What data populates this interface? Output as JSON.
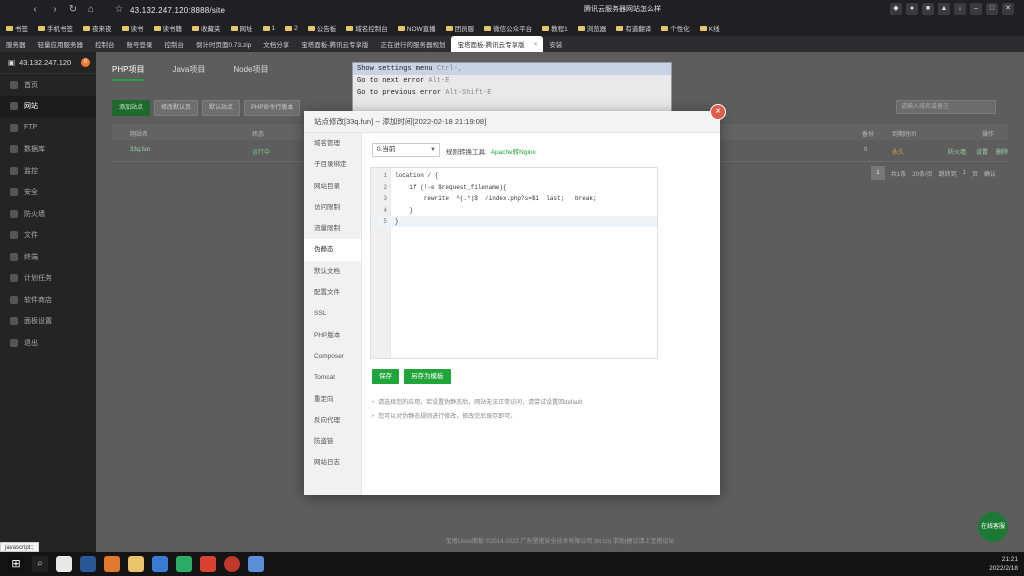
{
  "browser": {
    "address": "43.132.247.120:8888/site",
    "active_tab_title": "腾讯云服务器网站怎么样",
    "bookmarks": [
      "书签",
      "手机书签",
      "夜来夜",
      "读书",
      "读书籍",
      "收藏夹",
      "网址",
      "1",
      "2",
      "公告板",
      "域名控制台",
      "NOW直播",
      "团员服",
      "微信公众平台",
      "教程1",
      "浏览器",
      "有道翻译",
      "个性化",
      "K线"
    ],
    "tabs": [
      {
        "label": "服务器",
        "active": false
      },
      {
        "label": "轻量应用服务器",
        "active": false
      },
      {
        "label": "控制台",
        "active": false
      },
      {
        "label": "账号登录",
        "active": false
      },
      {
        "label": "控制台",
        "active": false
      },
      {
        "label": "倒计时页面0.73.zip",
        "active": false
      },
      {
        "label": "文档分享",
        "active": false
      },
      {
        "label": "宝塔面板-腾讯云专享版",
        "active": false
      },
      {
        "label": "正在进行的服务器规划",
        "active": false
      },
      {
        "label": "宝塔面板-腾讯云专享版",
        "active": true
      },
      {
        "label": "安装",
        "active": false
      }
    ]
  },
  "panel": {
    "server_ip": "43.132.247.120",
    "badge": "0",
    "nav": [
      "首页",
      "网站",
      "FTP",
      "数据库",
      "监控",
      "安全",
      "防火墙",
      "文件",
      "终端",
      "计划任务",
      "软件商店",
      "面板设置",
      "退出"
    ],
    "active_nav": "网站",
    "project_tabs": [
      "PHP项目",
      "Java项目",
      "Node项目"
    ],
    "toolbar": [
      "添加站点",
      "修改默认页",
      "默认站点",
      "PHP命令行版本"
    ],
    "search_placeholder": "请输入域名或备注",
    "columns": [
      "网站名",
      "状态",
      "备份",
      "到期时间",
      "操作"
    ],
    "row": {
      "name": "33q.fun",
      "status": "运行中",
      "backup": "0",
      "expire": "永久",
      "actions": [
        "防火墙",
        "设置",
        "删除"
      ]
    },
    "pager": {
      "page": "1",
      "total": "共1条",
      "per_page": "20条/页",
      "jump": "跳转到",
      "page_unit": "页",
      "confirm": "确认"
    },
    "footer": "宝塔Linux面板 ©2014-2022 广东堡塔安全技术有限公司 (bt.cn)   求助|建议请上宝塔论坛",
    "online_service": "在线客服"
  },
  "shortcuts": {
    "lines": [
      {
        "label": "Show settings menu",
        "key": "Ctrl-,"
      },
      {
        "label": "Go to next error",
        "key": "Alt-E"
      },
      {
        "label": "Go to previous error",
        "key": "Alt-Shift-E"
      }
    ]
  },
  "modal": {
    "title": "站点修改[33q.fun] -- 添加时间[2022-02-18 21:19:08]",
    "close_glyph": "×",
    "side_items": [
      "域名管理",
      "子目录绑定",
      "网站目录",
      "访问限制",
      "流量限制",
      "伪静态",
      "默认文档",
      "配置文件",
      "SSL",
      "PHP版本",
      "Composer",
      "Tomcat",
      "重定向",
      "反向代理",
      "防盗链",
      "网站日志"
    ],
    "active_side": "伪静态",
    "select_value": "0.当前",
    "convert_label": "规则转换工具:",
    "convert_link": "Apache转Nginx",
    "code_lines": [
      {
        "n": "1",
        "text": "location / {"
      },
      {
        "n": "2",
        "text": "    if (!-e $request_filename){"
      },
      {
        "n": "3",
        "text": "        rewrite  ^(.*)$  /index.php?s=$1  last;   break;"
      },
      {
        "n": "4",
        "text": "    }"
      },
      {
        "n": "5",
        "text": "}"
      }
    ],
    "save_label": "保存",
    "save_template_label": "另存为模板",
    "tips": [
      "请选择您的应用，若设置伪静态后，网站无法正常访问，请尝试设置回default",
      "您可以对伪静态规则进行修改，修改完后保存即可。"
    ]
  },
  "taskbar": {
    "time": "21:21",
    "date": "2022/2/18",
    "status_url": "javascript:;"
  }
}
